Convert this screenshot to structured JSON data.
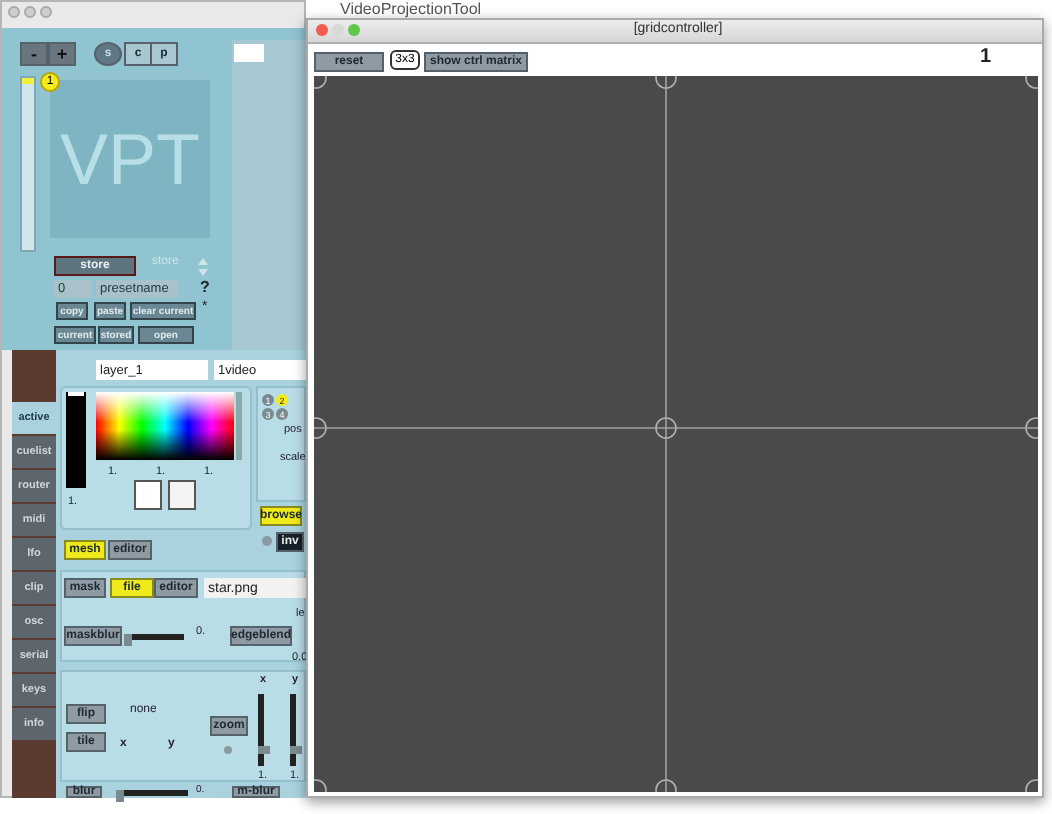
{
  "back_window": {
    "title": "VideoProjectionTool",
    "preset_bar": {
      "minus": "-",
      "plus": "+",
      "modes": [
        {
          "label": "s",
          "selected": true
        },
        {
          "label": "c",
          "selected": false
        },
        {
          "label": "p",
          "selected": false
        }
      ]
    },
    "preset_slider": {
      "level": 1
    },
    "slot_badge": "1",
    "logo": "VPT",
    "store": {
      "button": "store",
      "menu": "store",
      "number": "0",
      "name": "presetname",
      "help": "?",
      "copy": "copy",
      "paste": "paste",
      "clear": "clear current",
      "mark": "*",
      "current": "current",
      "stored": "stored",
      "open": "open"
    },
    "tabs": [
      {
        "label": "active",
        "selected": true
      },
      {
        "label": "cuelist",
        "selected": false
      },
      {
        "label": "router",
        "selected": false
      },
      {
        "label": "midi",
        "selected": false
      },
      {
        "label": "lfo",
        "selected": false
      },
      {
        "label": "clip",
        "selected": false
      },
      {
        "label": "osc",
        "selected": false
      },
      {
        "label": "serial",
        "selected": false
      },
      {
        "label": "keys",
        "selected": false
      },
      {
        "label": "info",
        "selected": false
      }
    ],
    "layer": {
      "name": "layer_1",
      "source": "1video"
    },
    "color": {
      "level": 1,
      "brightness": "1.",
      "values": [
        "1.",
        "1.",
        "1."
      ]
    },
    "corners": [
      {
        "label": "1",
        "selected": false
      },
      {
        "label": "2",
        "selected": true
      },
      {
        "label": "3",
        "selected": false
      },
      {
        "label": "4",
        "selected": false
      }
    ],
    "pos_label": "pos",
    "scale_label": "scale",
    "browse": {
      "label": "browse",
      "on": true
    },
    "inv": "inv",
    "mesh": {
      "label": "mesh",
      "on": true
    },
    "mesh_editor": {
      "label": "editor",
      "on": false
    },
    "mask": {
      "label": "mask",
      "on": false
    },
    "mask_file": {
      "label": "file",
      "on": true
    },
    "mask_editor": {
      "label": "editor",
      "on": false
    },
    "mask_filename": "star.png",
    "maskblur": {
      "label": "maskblur",
      "level": 0,
      "reading": "0."
    },
    "edgeblend": "edgeblend",
    "edge_label": "le",
    "edge_value": "0.0",
    "flip": "flip",
    "tile": "tile",
    "flip_mode": "none",
    "x_label": "x",
    "y_label": "y",
    "zoom": "zoom",
    "zoom_sliders": [
      {
        "label": "x",
        "level": 0.2,
        "reading": "1."
      },
      {
        "label": "y",
        "level": 0.2,
        "reading": "1."
      }
    ],
    "blur": {
      "label": "blur",
      "level": 0,
      "reading": "0."
    },
    "mblur": "m-blur"
  },
  "front_window": {
    "title": "[gridcontroller]",
    "reset": "reset",
    "size": "3x3",
    "show_matrix": "show ctrl matrix",
    "number": "1"
  }
}
